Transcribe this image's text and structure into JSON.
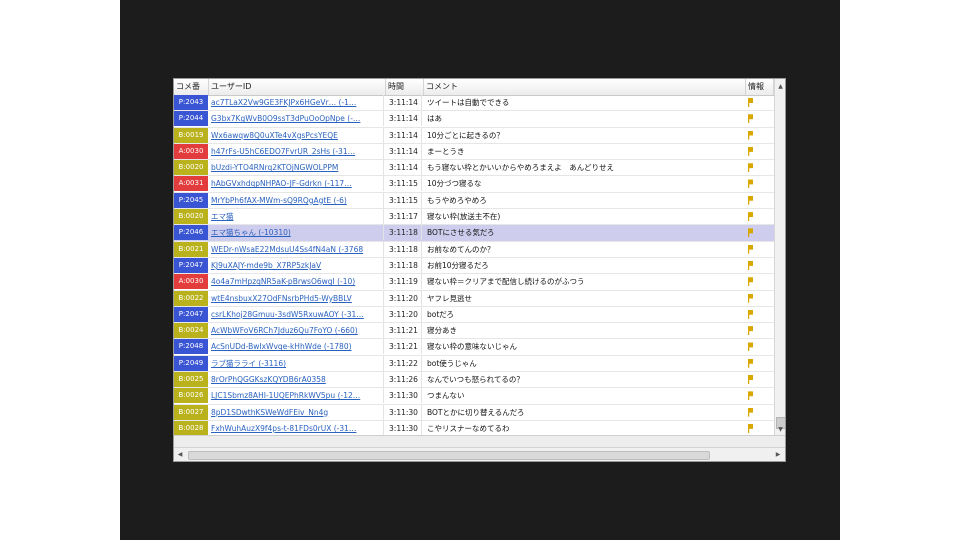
{
  "columns": {
    "num": "コメ番",
    "uid": "ユーザーID",
    "time": "時間",
    "comment": "コメント",
    "info": "情報"
  },
  "colors": {
    "blue": "#3a55d4",
    "olive": "#b9b21c",
    "red": "#e23c3c",
    "selected_row": "#cfcdee",
    "link": "#2a62c0",
    "info_flag": "#d8a800"
  },
  "rows": [
    {
      "num": "P:2043",
      "color": "#3a55d4",
      "uid": "ac7TLaX2Vw9GE3FKJPx6HGeVr… (-1…",
      "time": "3:11:14",
      "comment": "ツイートは自動でできる",
      "info": "P"
    },
    {
      "num": "P:2044",
      "color": "#3a55d4",
      "uid": "G3bx7KgWvB0O9ssT3dPuOoOpNpe (-…",
      "time": "3:11:14",
      "comment": "はあ",
      "info": "P"
    },
    {
      "num": "B:0019",
      "color": "#b9b21c",
      "uid": "Wx6awqw8Q0uXTe4vXgsPcsYEQE",
      "time": "3:11:14",
      "comment": "10分ごとに起きるの？",
      "info": "P"
    },
    {
      "num": "A:0030",
      "color": "#e23c3c",
      "uid": "h47rFs-U5hC6EDO7FvrUR_2sHs (-31…",
      "time": "3:11:14",
      "comment": "まーとうき",
      "info": "P"
    },
    {
      "num": "B:0020",
      "color": "#b9b21c",
      "uid": "bUzdi-YTO4RNrq2KTOjNGWOLPPM",
      "time": "3:11:14",
      "comment": "もう寝ない枠とかいいからやめろまえよ　あんどりせえ",
      "info": "P"
    },
    {
      "num": "A:0031",
      "color": "#e23c3c",
      "uid": "hAbGVxhdqpNHPAO-JF-Gdrkn (-117…",
      "time": "3:11:15",
      "comment": "10分づつ寝るな",
      "info": "P"
    },
    {
      "num": "P:2045",
      "color": "#3a55d4",
      "uid": "MrYbPh6fAX-MWm-sQ9RQgAgtE (-6)",
      "time": "3:11:15",
      "comment": "もうやめろやめろ",
      "info": "P"
    },
    {
      "num": "B:0020",
      "color": "#b9b21c",
      "uid": "エマ猫",
      "time": "3:11:17",
      "comment": "寝ない枠(放送主不在)",
      "info": "P"
    },
    {
      "num": "P:2046",
      "color": "#3a55d4",
      "uid": "エマ猫ちゃん (-10310)",
      "time": "3:11:18",
      "comment": "BOTにさせる気だろ",
      "info": "P"
    },
    {
      "num": "B:0021",
      "color": "#b9b21c",
      "uid": "WEDr-nWsaE22MdsuU4Ss4fN4aN (-3768",
      "time": "3:11:18",
      "comment": "お前なめてんのか？",
      "info": "P"
    },
    {
      "num": "P:2047",
      "color": "#3a55d4",
      "uid": "KJ9uXAJY-mde9b_X7RP5zkJaV",
      "time": "3:11:18",
      "comment": "お前10分寝るだろ",
      "info": "P"
    },
    {
      "num": "A:0030",
      "color": "#e23c3c",
      "uid": "4o4a7mHpzqNR5aK-pBrwsO6wgI (-10)",
      "time": "3:11:19",
      "comment": "寝ない枠＝クリアまで配信し続けるのがふつう",
      "info": "P"
    },
    {
      "num": "B:0022",
      "color": "#b9b21c",
      "uid": "wtE4nsbuxX27OdFNsrbPHd5-WyBBLV",
      "time": "3:11:20",
      "comment": "ヤフレ見逃せ",
      "info": "P"
    },
    {
      "num": "P:2047",
      "color": "#3a55d4",
      "uid": "csrLKhoj28Gmuu-3sdW5RxuwAOY (-31…",
      "time": "3:11:20",
      "comment": "botだろ",
      "info": "P"
    },
    {
      "num": "B:0024",
      "color": "#b9b21c",
      "uid": "AcWbWFoV6RCh7Jduz6Qu7FoYO (-660)",
      "time": "3:11:21",
      "comment": "寝分あき",
      "info": "P"
    },
    {
      "num": "P:2048",
      "color": "#3a55d4",
      "uid": "AcSnUDd-BwIxWvqe-kHhWde (-1780)",
      "time": "3:11:21",
      "comment": "寝ない枠の意味ないじゃん",
      "info": "P"
    },
    {
      "num": "P:2049",
      "color": "#3a55d4",
      "uid": "ラブ猫ラライ (-3116)",
      "time": "3:11:22",
      "comment": "bot使うじゃん",
      "info": "P"
    },
    {
      "num": "B:0025",
      "color": "#b9b21c",
      "uid": "8rOrPhQGGKszKQYDB6rA0358",
      "time": "3:11:26",
      "comment": "なんでいつも怒られてるの？",
      "info": "P"
    },
    {
      "num": "B:0026",
      "color": "#b9b21c",
      "uid": "LJC1Sbmz8AHI-1UQEPhRkWV5pu (-12…",
      "time": "3:11:30",
      "comment": "つまんない",
      "info": "P"
    },
    {
      "num": "B:0027",
      "color": "#b9b21c",
      "uid": "8pD1SDwthKSWeWdFEiv_Nn4g",
      "time": "3:11:30",
      "comment": "BOTとかに切り替えるんだろ",
      "info": "P"
    },
    {
      "num": "B:0028",
      "color": "#b9b21c",
      "uid": "FxhWuhAuzX9f4ps-t-81FDs0rUX (-31…",
      "time": "3:11:30",
      "comment": "こやリスナーなめてるわ",
      "info": "P"
    }
  ],
  "selected_index": 8,
  "icons": {
    "scroll_up": "triangle-up-icon",
    "scroll_down": "triangle-down-icon",
    "scroll_left": "triangle-left-icon",
    "scroll_right": "triangle-right-icon",
    "info_flag": "p-flag-icon"
  }
}
